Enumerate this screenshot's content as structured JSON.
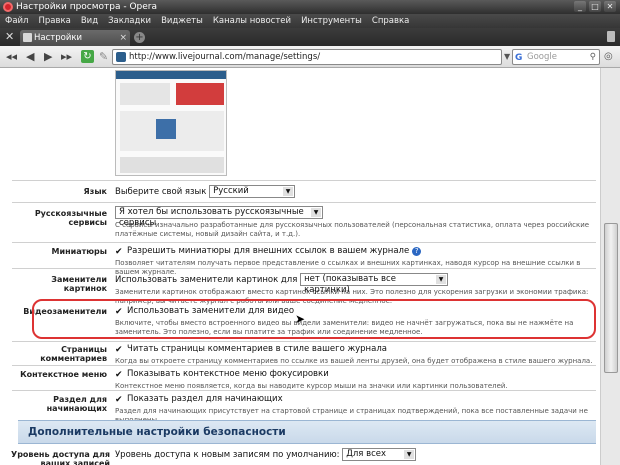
{
  "window": {
    "title": "Настройки просмотра - Opera",
    "min": "_",
    "max": "□",
    "close": "✕"
  },
  "menu": [
    "Файл",
    "Правка",
    "Вид",
    "Закладки",
    "Виджеты",
    "Каналы новостей",
    "Инструменты",
    "Справка"
  ],
  "tab": {
    "label": "Настройки просмотра",
    "close": "×",
    "new_tab": "+"
  },
  "nav": {
    "url": "http://www.livejournal.com/manage/settings/",
    "search_placeholder": "Google",
    "search_logo": "G"
  },
  "settings": {
    "language": {
      "label": "Язык",
      "prompt": "Выберите свой язык",
      "selected": "Русский"
    },
    "russian_services": {
      "label": "Русскоязычные сервисы",
      "selected": "Я хотел бы использовать русскоязычные сервисы",
      "desc": "С сервисы изначально разработанные для русскоязычных пользователей (персональная статистика, оплата через российские платёжные системы, новый дизайн сайта, и т.д.)."
    },
    "thumbnails": {
      "label": "Миниатюры",
      "checkbox": "Разрешить миниатюры для внешних ссылок в вашем журнале",
      "desc": "Позволяет читателям получать первое представление о ссылках и внешних картинках, наводя курсор на внешние ссылки в вашем журнале."
    },
    "image_placeholders": {
      "label": "Заменители картинок",
      "prompt": "Использовать заменители картинок для",
      "selected": "нет (показывать все картинки)",
      "desc": "Заменители картинок отображают вместо картинок ссылки на них. Это полезно для ускорения загрузки и экономии трафика: например, вы читаете журнал с работы или ваше соединение медленное."
    },
    "video_placeholders": {
      "label": "Видеозаменители",
      "checkbox": "Использовать заменители для видео",
      "desc": "Включите, чтобы вместо встроенного видео вы видели заменители: видео не начнёт загружаться, пока вы не нажмёте на заменитель. Это полезно, если вы платите за трафик или соединение медленное."
    },
    "comment_pages": {
      "label": "Страницы комментариев",
      "checkbox": "Читать страницы комментариев в стиле вашего журнала",
      "desc": "Когда вы откроете страницу комментариев по ссылке из вашей ленты друзей, она будет отображена в стиле вашего журнала."
    },
    "context_menu": {
      "label": "Контекстное меню",
      "checkbox": "Показывать контекстное меню фокусировки",
      "desc": "Контекстное меню появляется, когда вы наводите курсор мыши на значки или картинки пользователей."
    },
    "beginners": {
      "label": "Раздел для начинающих",
      "checkbox": "Показать раздел для начинающих",
      "desc": "Раздел для начинающих присутствует на стартовой странице и страницах подтверждений, пока все поставленные задачи не выполнены."
    },
    "security_section": "Дополнительные настройки безопасности",
    "access_level": {
      "label": "Уровень доступа для ваших записей",
      "prompt": "Уровень доступа к новым записям по умолчанию:",
      "selected": "Для всех"
    }
  },
  "colors": {
    "highlight": "#dd3333",
    "section_bg": "#d4e2f0",
    "reload": "#46a846"
  }
}
